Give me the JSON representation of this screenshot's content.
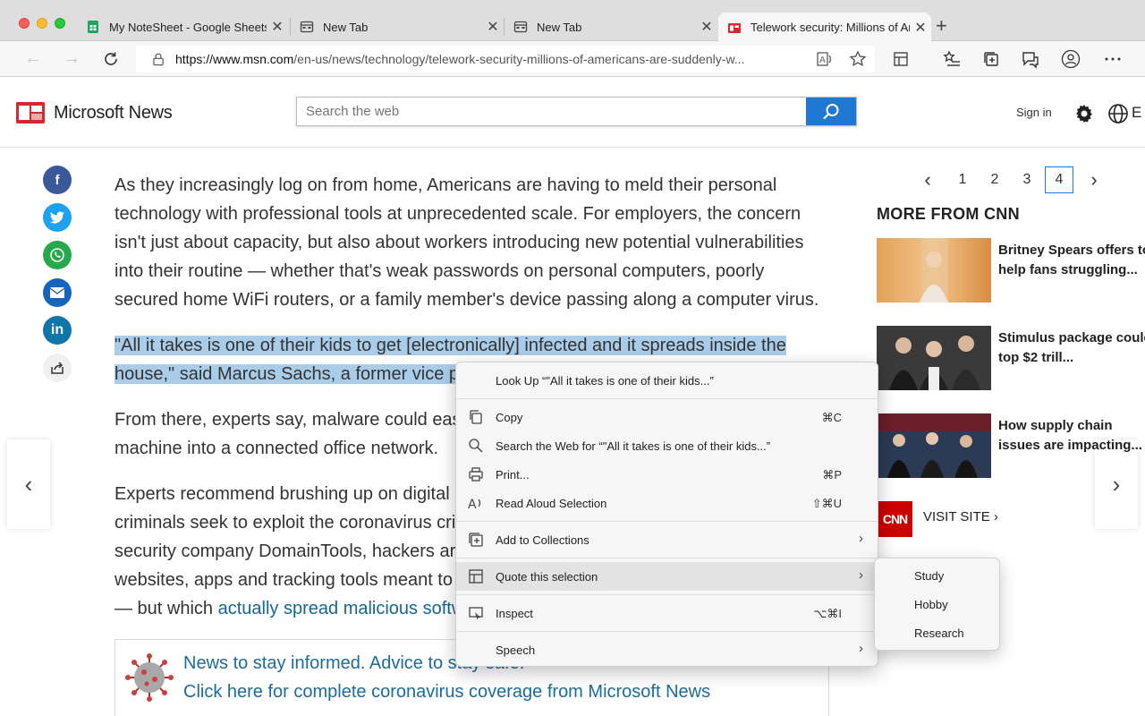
{
  "browser": {
    "tabs": [
      {
        "title": "My NoteSheet - Google Sheets",
        "favicon": "google-sheets-icon",
        "active": false
      },
      {
        "title": "New Tab",
        "favicon": "new-tab-icon",
        "active": false
      },
      {
        "title": "New Tab",
        "favicon": "new-tab-icon",
        "active": false
      },
      {
        "title": "Telework security: Millions of Americans",
        "favicon": "msn-news-icon",
        "active": true
      }
    ],
    "new_tab_label": "+",
    "url_host": "https://www.msn.com",
    "url_path": "/en-us/news/technology/telework-security-millions-of-americans-are-suddenly-w..."
  },
  "site": {
    "brand": "Microsoft News",
    "search_placeholder": "Search the web",
    "signin": "Sign in",
    "header_trailing": "E"
  },
  "article": {
    "paragraph1": "As they increasingly log on from home, Americans are having to meld their personal technology with professional tools at unprecedented scale. For employers, the concern isn't just about capacity, but also about workers introducing new potential vulnerabilities into their routine — whether that's weak passwords on personal computers, poorly secured home WiFi routers, or a family member's device passing along a computer virus.",
    "paragraph2_line1": "\"All it takes is one of their kids to get [electronically] infected and it spreads inside the",
    "paragraph2_line2": "house,\" said Marcus Sachs, a former vice pr",
    "paragraph3_line1": "From there, experts say, malware could easi",
    "paragraph3_line2": "machine into a connected office network.",
    "paragraph4_line1": "Experts recommend brushing up on digital",
    "paragraph4_line2": "criminals seek to exploit the coronavirus cri",
    "paragraph4_line3": "security company DomainTools, hackers are",
    "paragraph4_line4": "websites, apps and tracking tools meant to",
    "paragraph4_line5_prefix": "— but which ",
    "paragraph4_link": "actually spread malicious softw",
    "promo_line1": "News to stay informed. Advice to stay safe.",
    "promo_line2": "Click here for complete coronavirus coverage from Microsoft News"
  },
  "rail": {
    "pages": [
      "1",
      "2",
      "3",
      "4"
    ],
    "current_page": "4",
    "title": "MORE FROM CNN",
    "stories": [
      {
        "title_line1": "Britney Spears offers to",
        "title_line2": "help fans struggling..."
      },
      {
        "title_line1": "Stimulus package could",
        "title_line2": "top $2 trill..."
      },
      {
        "title_line1": "How supply chain",
        "title_line2": "issues are impacting..."
      }
    ],
    "cnn_logo": "CNN",
    "visit_site": "VISIT SITE"
  },
  "context_menu": {
    "lookup": "Look Up “\"All it takes is one of their kids...”",
    "copy": "Copy",
    "copy_shortcut": "⌘C",
    "search_web": "Search the Web for “\"All it takes is one of their kids...”",
    "print": "Print...",
    "print_shortcut": "⌘P",
    "read_aloud": "Read Aloud Selection",
    "read_aloud_shortcut": "⇧⌘U",
    "add_collections": "Add to Collections",
    "quote": "Quote this selection",
    "inspect": "Inspect",
    "inspect_shortcut": "⌥⌘I",
    "speech": "Speech"
  },
  "submenu": {
    "items": [
      "Study",
      "Hobby",
      "Research"
    ]
  }
}
